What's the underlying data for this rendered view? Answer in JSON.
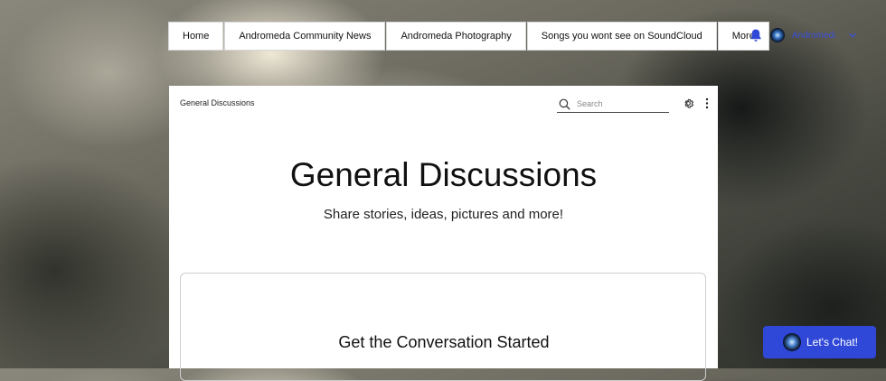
{
  "nav": {
    "items": [
      {
        "label": "Home"
      },
      {
        "label": "Andromeda Community News"
      },
      {
        "label": "Andromeda Photography"
      },
      {
        "label": "Songs you wont see on SoundCloud"
      },
      {
        "label": "More"
      }
    ]
  },
  "member": {
    "name": "Andromeda",
    "bell_icon": "bell-icon",
    "chevron_icon": "chevron-down-icon"
  },
  "panel": {
    "breadcrumb": "General Discussions",
    "search": {
      "placeholder": "Search",
      "value": ""
    },
    "title": "General Discussions",
    "subtitle": "Share stories, ideas, pictures and more!",
    "empty_state_title": "Get the Conversation Started"
  },
  "chat": {
    "label": "Let's Chat!"
  },
  "colors": {
    "accent": "#2f48d8",
    "member_link": "#3b4fd8"
  }
}
